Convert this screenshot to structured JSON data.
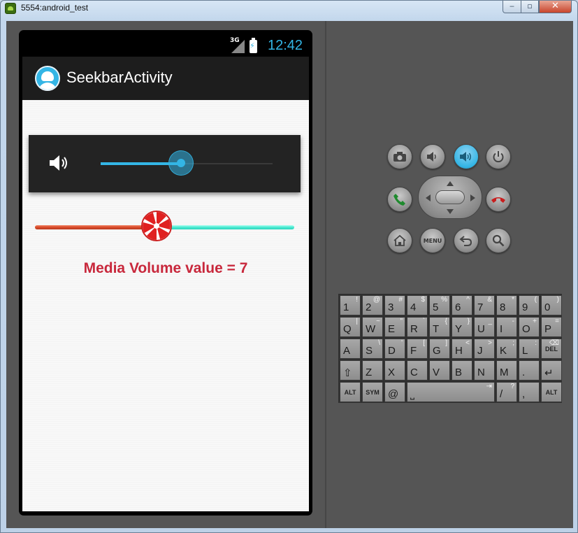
{
  "window": {
    "title": "5554:android_test",
    "minimize": "‒",
    "maximize": "▫",
    "close": "✕"
  },
  "statusbar": {
    "network": "3G",
    "time": "12:42"
  },
  "app": {
    "title": "SeekbarActivity",
    "volume_slider": {
      "value": 7,
      "max": 15
    },
    "custom_seekbar": {
      "fraction": 0.47
    },
    "volume_text": "Media Volume value = 7"
  },
  "colors": {
    "holo_blue": "#33b5e5",
    "seek_left": "#d84b2a",
    "seek_right": "#48e8d0",
    "volume_text": "#c8283c"
  },
  "controls": {
    "menu_label": "MENU",
    "icons": [
      "camera-icon",
      "volume-down-icon",
      "volume-up-icon",
      "power-icon",
      "call-icon",
      "end-call-icon",
      "home-icon",
      "menu-icon",
      "back-icon",
      "search-icon"
    ]
  },
  "keyboard": {
    "rows": [
      [
        {
          "k": "1",
          "a": "!"
        },
        {
          "k": "2",
          "a": "@"
        },
        {
          "k": "3",
          "a": "#"
        },
        {
          "k": "4",
          "a": "$"
        },
        {
          "k": "5",
          "a": "%"
        },
        {
          "k": "6",
          "a": "^"
        },
        {
          "k": "7",
          "a": "&"
        },
        {
          "k": "8",
          "a": "*"
        },
        {
          "k": "9",
          "a": "("
        },
        {
          "k": "0",
          "a": ")"
        }
      ],
      [
        {
          "k": "Q",
          "a": "|"
        },
        {
          "k": "W",
          "a": "~"
        },
        {
          "k": "E",
          "a": "\""
        },
        {
          "k": "R",
          "a": "`"
        },
        {
          "k": "T",
          "a": "{"
        },
        {
          "k": "Y",
          "a": "}"
        },
        {
          "k": "U",
          "a": "_"
        },
        {
          "k": "I",
          "a": "-"
        },
        {
          "k": "O",
          "a": "+"
        },
        {
          "k": "P",
          "a": "="
        }
      ],
      [
        {
          "k": "A",
          "a": ""
        },
        {
          "k": "S",
          "a": "\\"
        },
        {
          "k": "D",
          "a": "'"
        },
        {
          "k": "F",
          "a": "["
        },
        {
          "k": "G",
          "a": "]"
        },
        {
          "k": "H",
          "a": "<"
        },
        {
          "k": "J",
          "a": ">"
        },
        {
          "k": "K",
          "a": ";"
        },
        {
          "k": "L",
          "a": ":"
        },
        {
          "k": "DEL",
          "a": "⌫"
        }
      ],
      [
        {
          "k": "⇧",
          "a": ""
        },
        {
          "k": "Z",
          "a": ""
        },
        {
          "k": "X",
          "a": ""
        },
        {
          "k": "C",
          "a": ""
        },
        {
          "k": "V",
          "a": ""
        },
        {
          "k": "B",
          "a": ""
        },
        {
          "k": "N",
          "a": ""
        },
        {
          "k": "M",
          "a": ""
        },
        {
          "k": ".",
          "a": ""
        },
        {
          "k": "↵",
          "a": ""
        }
      ],
      [
        {
          "k": "ALT",
          "a": ""
        },
        {
          "k": "SYM",
          "a": ""
        },
        {
          "k": "@",
          "a": ""
        },
        {
          "k": "⎵",
          "a": "⇥"
        },
        {
          "k": "/",
          "a": "?"
        },
        {
          "k": ",",
          "a": ""
        },
        {
          "k": "ALT",
          "a": ""
        }
      ]
    ]
  }
}
